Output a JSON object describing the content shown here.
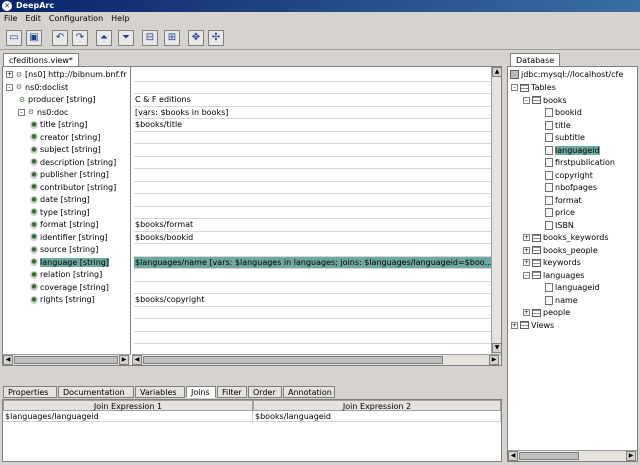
{
  "window": {
    "title": "DeepArc"
  },
  "menu": [
    "File",
    "Edit",
    "Configuration",
    "Help"
  ],
  "toolbar_icons": [
    "new-icon",
    "save-icon",
    "undo-icon",
    "redo-icon",
    "move-up-icon",
    "move-down-icon",
    "collapse-icon",
    "expand-icon",
    "connect-icon",
    "disconnect-icon"
  ],
  "editor": {
    "tab": "cfeditions.view*",
    "tree": [
      {
        "label": "[ns0] http://bibnum.bnf.fr",
        "depth": 0,
        "kind": "root",
        "expander": "+",
        "value": ""
      },
      {
        "label": "ns0:doclist",
        "depth": 0,
        "kind": "elem",
        "expander": "-",
        "value": ""
      },
      {
        "label": "producer [string]",
        "depth": 1,
        "kind": "gear",
        "expander": "",
        "value": "C & F editions"
      },
      {
        "label": "ns0:doc",
        "depth": 1,
        "kind": "elem",
        "expander": "-",
        "value": "[vars: $books in books]"
      },
      {
        "label": "title [string]",
        "depth": 2,
        "kind": "attr",
        "expander": "",
        "value": "$books/title"
      },
      {
        "label": "creator [string]",
        "depth": 2,
        "kind": "attr",
        "expander": "",
        "value": ""
      },
      {
        "label": "subject [string]",
        "depth": 2,
        "kind": "attr",
        "expander": "",
        "value": ""
      },
      {
        "label": "description [string]",
        "depth": 2,
        "kind": "attr",
        "expander": "",
        "value": ""
      },
      {
        "label": "publisher [string]",
        "depth": 2,
        "kind": "attr",
        "expander": "",
        "value": ""
      },
      {
        "label": "contributor [string]",
        "depth": 2,
        "kind": "attr",
        "expander": "",
        "value": ""
      },
      {
        "label": "date [string]",
        "depth": 2,
        "kind": "attr",
        "expander": "",
        "value": ""
      },
      {
        "label": "type [string]",
        "depth": 2,
        "kind": "attr",
        "expander": "",
        "value": ""
      },
      {
        "label": "format [string]",
        "depth": 2,
        "kind": "attr",
        "expander": "",
        "value": "$books/format"
      },
      {
        "label": "identifier [string]",
        "depth": 2,
        "kind": "attr",
        "expander": "",
        "value": "$books/bookid"
      },
      {
        "label": "source [string]",
        "depth": 2,
        "kind": "attr",
        "expander": "",
        "value": ""
      },
      {
        "label": "language [string]",
        "depth": 2,
        "kind": "attr",
        "expander": "",
        "value": "$languages/name [vars: $languages in languages; joins: $languages/languageid=$boo...",
        "selected": true
      },
      {
        "label": "relation [string]",
        "depth": 2,
        "kind": "attr",
        "expander": "",
        "value": ""
      },
      {
        "label": "coverage [string]",
        "depth": 2,
        "kind": "attr",
        "expander": "",
        "value": ""
      },
      {
        "label": "rights [string]",
        "depth": 2,
        "kind": "attr",
        "expander": "",
        "value": "$books/copyright"
      }
    ]
  },
  "bottom": {
    "tabs": [
      "Properties",
      "Documentation",
      "Variables",
      "Joins",
      "Filter",
      "Order",
      "Annotation"
    ],
    "active_tab": "Joins",
    "columns": [
      "Join Expression 1",
      "Join Expression 2"
    ],
    "rows": [
      [
        "$languages/languageid",
        "$books/languageid"
      ]
    ]
  },
  "database": {
    "tab": "Database",
    "connection": "jdbc:mysql://localhost/cfe",
    "tree": [
      {
        "label": "Tables",
        "depth": 0,
        "kind": "table",
        "expander": "-"
      },
      {
        "label": "books",
        "depth": 1,
        "kind": "table",
        "expander": "-"
      },
      {
        "label": "bookid",
        "depth": 2,
        "kind": "col",
        "expander": ""
      },
      {
        "label": "title",
        "depth": 2,
        "kind": "col",
        "expander": ""
      },
      {
        "label": "subtitle",
        "depth": 2,
        "kind": "col",
        "expander": ""
      },
      {
        "label": "languageid",
        "depth": 2,
        "kind": "col",
        "expander": "",
        "selected": true
      },
      {
        "label": "firstpublication",
        "depth": 2,
        "kind": "col",
        "expander": ""
      },
      {
        "label": "copyright",
        "depth": 2,
        "kind": "col",
        "expander": ""
      },
      {
        "label": "nbofpages",
        "depth": 2,
        "kind": "col",
        "expander": ""
      },
      {
        "label": "format",
        "depth": 2,
        "kind": "col",
        "expander": ""
      },
      {
        "label": "price",
        "depth": 2,
        "kind": "col",
        "expander": ""
      },
      {
        "label": "ISBN",
        "depth": 2,
        "kind": "col",
        "expander": ""
      },
      {
        "label": "books_keywords",
        "depth": 1,
        "kind": "table",
        "expander": "+"
      },
      {
        "label": "books_people",
        "depth": 1,
        "kind": "table",
        "expander": "+"
      },
      {
        "label": "keywords",
        "depth": 1,
        "kind": "table",
        "expander": "+"
      },
      {
        "label": "languages",
        "depth": 1,
        "kind": "table",
        "expander": "-"
      },
      {
        "label": "languageid",
        "depth": 2,
        "kind": "col",
        "expander": ""
      },
      {
        "label": "name",
        "depth": 2,
        "kind": "col",
        "expander": ""
      },
      {
        "label": "people",
        "depth": 1,
        "kind": "table",
        "expander": "+"
      },
      {
        "label": "Views",
        "depth": 0,
        "kind": "table",
        "expander": "+"
      }
    ]
  }
}
